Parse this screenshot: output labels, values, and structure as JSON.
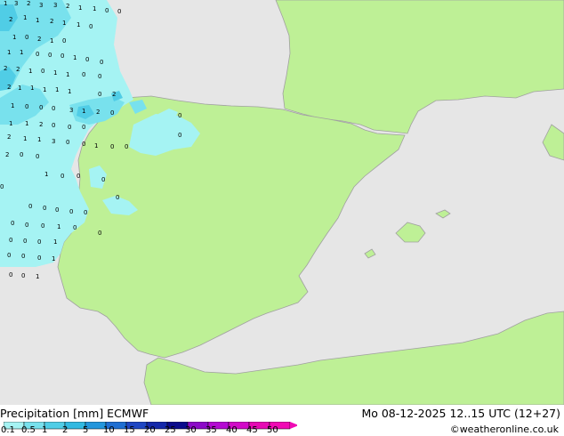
{
  "map": {
    "precip_labels": [
      {
        "t": "1"
      },
      {
        "t": "3"
      },
      {
        "t": "2"
      },
      {
        "t": "3"
      },
      {
        "t": "3"
      },
      {
        "t": "2"
      },
      {
        "t": "1"
      },
      {
        "t": "1"
      },
      {
        "t": "0"
      },
      {
        "t": "0"
      },
      {
        "t": "2"
      },
      {
        "t": "1"
      },
      {
        "t": "1"
      },
      {
        "t": "2"
      },
      {
        "t": "1"
      },
      {
        "t": "1"
      },
      {
        "t": "0"
      },
      {
        "t": "1"
      },
      {
        "t": "0"
      },
      {
        "t": "2"
      },
      {
        "t": "1"
      },
      {
        "t": "0"
      },
      {
        "t": "1"
      },
      {
        "t": "1"
      },
      {
        "t": "0"
      },
      {
        "t": "0"
      },
      {
        "t": "0"
      },
      {
        "t": "1"
      },
      {
        "t": "0"
      },
      {
        "t": "0"
      },
      {
        "t": "2"
      },
      {
        "t": "2"
      },
      {
        "t": "1"
      },
      {
        "t": "0"
      },
      {
        "t": "1"
      },
      {
        "t": "1"
      },
      {
        "t": "0"
      },
      {
        "t": "0"
      },
      {
        "t": "2"
      },
      {
        "t": "1"
      },
      {
        "t": "1"
      },
      {
        "t": "1"
      },
      {
        "t": "1"
      },
      {
        "t": "1"
      },
      {
        "t": "0"
      },
      {
        "t": "2"
      },
      {
        "t": "1"
      },
      {
        "t": "0"
      },
      {
        "t": "0"
      },
      {
        "t": "0"
      },
      {
        "t": "3"
      },
      {
        "t": "1"
      },
      {
        "t": "2"
      },
      {
        "t": "0"
      },
      {
        "t": "1"
      },
      {
        "t": "1"
      },
      {
        "t": "2"
      },
      {
        "t": "0"
      },
      {
        "t": "0"
      },
      {
        "t": "0"
      },
      {
        "t": "2"
      },
      {
        "t": "1"
      },
      {
        "t": "1"
      },
      {
        "t": "3"
      },
      {
        "t": "0"
      },
      {
        "t": "0"
      },
      {
        "t": "1"
      },
      {
        "t": "0"
      },
      {
        "t": "0"
      },
      {
        "t": "2"
      },
      {
        "t": "0"
      },
      {
        "t": "0"
      },
      {
        "t": "0"
      },
      {
        "t": "1"
      },
      {
        "t": "0"
      },
      {
        "t": "0"
      },
      {
        "t": "0"
      },
      {
        "t": "0"
      },
      {
        "t": "0"
      },
      {
        "t": "0"
      },
      {
        "t": "0"
      },
      {
        "t": "0"
      },
      {
        "t": "0"
      },
      {
        "t": "0"
      },
      {
        "t": "1"
      },
      {
        "t": "0"
      },
      {
        "t": "0"
      },
      {
        "t": "0"
      },
      {
        "t": "0"
      },
      {
        "t": "1"
      },
      {
        "t": "0"
      },
      {
        "t": "0"
      },
      {
        "t": "0"
      },
      {
        "t": "1"
      },
      {
        "t": "0"
      },
      {
        "t": "0"
      },
      {
        "t": "1"
      },
      {
        "t": "0"
      },
      {
        "t": "0"
      },
      {
        "t": "0"
      },
      {
        "t": "0"
      },
      {
        "t": "0"
      }
    ]
  },
  "footer": {
    "title": "Precipitation [mm]  ECMWF",
    "datetime": "Mo 08-12-2025 12..15 UTC (12+27)",
    "credit": "©weatheronline.co.uk",
    "scale_labels": [
      "0.1",
      "0.5",
      "1",
      "2",
      "5",
      "10",
      "15",
      "20",
      "25",
      "30",
      "35",
      "40",
      "45",
      "50"
    ],
    "scale_colors": [
      "#a5f3f3",
      "#78e1ed",
      "#50cde6",
      "#32b9e1",
      "#2396dc",
      "#1e6ed2",
      "#1e46c3",
      "#1428aa",
      "#0a0a8c",
      "#8c0ac8",
      "#b40ad2",
      "#d20ac8",
      "#e60ab4",
      "#f00ab4"
    ]
  }
}
